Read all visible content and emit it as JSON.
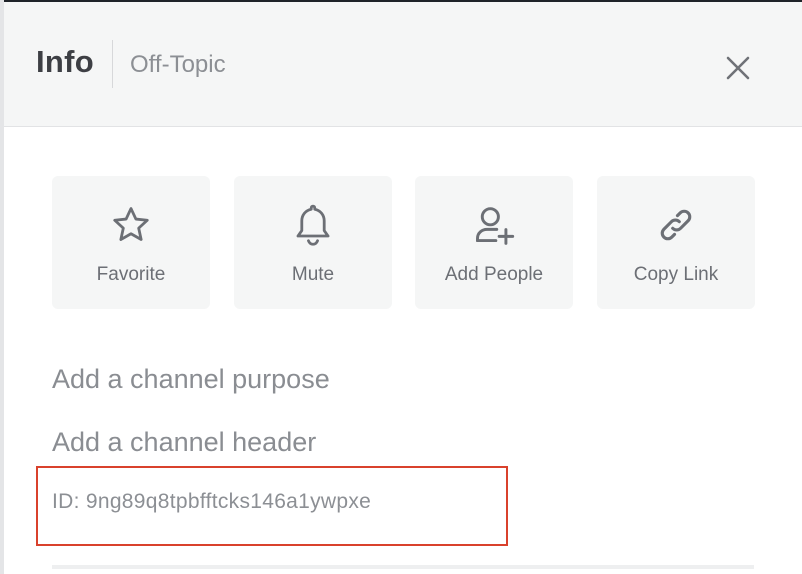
{
  "header": {
    "title": "Info",
    "subtitle": "Off-Topic",
    "close_icon": "close-icon"
  },
  "actions": [
    {
      "label": "Favorite",
      "icon": "star-icon"
    },
    {
      "label": "Mute",
      "icon": "bell-icon"
    },
    {
      "label": "Add People",
      "icon": "add-user-icon"
    },
    {
      "label": "Copy Link",
      "icon": "link-icon"
    }
  ],
  "channel": {
    "purpose_placeholder": "Add a channel purpose",
    "header_placeholder": "Add a channel header",
    "id_text": "ID: 9ng89q8tpbfftcks146a1ywpxe"
  },
  "colors": {
    "highlight": "#d9412c",
    "panel_bg": "#f5f6f6",
    "text": "#3d3f44",
    "muted_text": "#8c8f94"
  }
}
